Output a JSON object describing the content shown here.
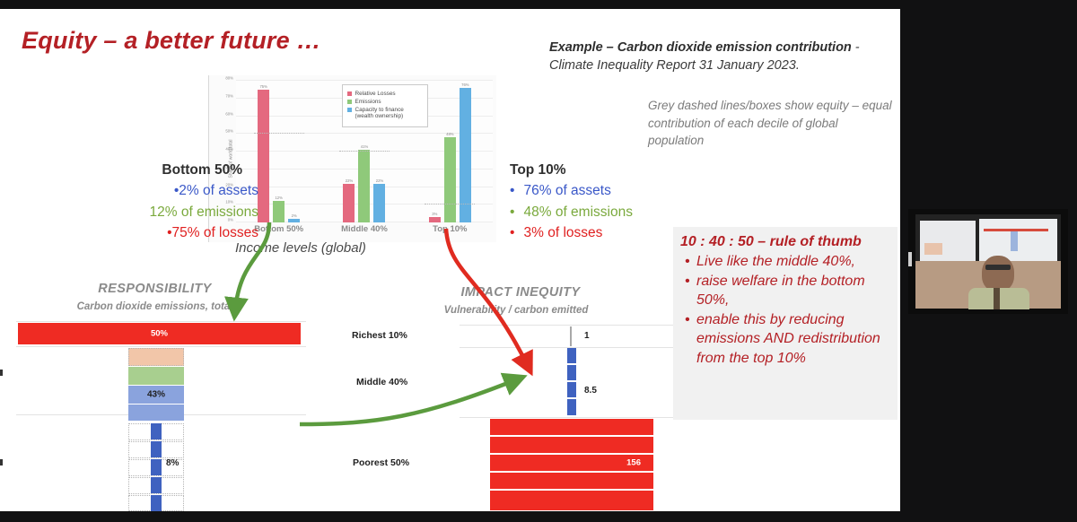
{
  "slide": {
    "title": "Equity – a better future …",
    "example_note_bold": "Example – Carbon dioxide emission contribution",
    "example_note_rest": " - Climate Inequality Report 31 January 2023.",
    "grey_note": "Grey dashed lines/boxes show equity – equal contribution of each decile of global population"
  },
  "stats": {
    "bottom": {
      "heading": "Bottom 50%",
      "rows": [
        {
          "text": "2% of assets",
          "color": "#3a58c8"
        },
        {
          "text": "12% of emissions",
          "color": "#7aa93c"
        },
        {
          "text": "75% of losses",
          "color": "#e02020"
        }
      ]
    },
    "top": {
      "heading": "Top 10%",
      "rows": [
        {
          "text": "76% of assets",
          "color": "#3a58c8"
        },
        {
          "text": "48% of emissions",
          "color": "#7aa93c"
        },
        {
          "text": "3% of losses",
          "color": "#e02020"
        }
      ]
    }
  },
  "rule_box": {
    "heading": "10 : 40 : 50 – rule of thumb",
    "bullets": [
      "Live like the middle 40%,",
      "raise welfare in the bottom 50%,",
      "enable this by reducing emissions AND redistribution from the top 10%"
    ],
    "color": "#b42025"
  },
  "responsibility": {
    "heading": "RESPONSIBILITY",
    "subheading": "Carbon dioxide emissions, total",
    "values": [
      {
        "label": "50%",
        "group": "top-10"
      },
      {
        "label": "43%",
        "group": "middle-40"
      },
      {
        "label": "8%",
        "group": "bottom-50"
      }
    ]
  },
  "impact": {
    "heading": "IMPACT INEQUITY",
    "subheading": "Vulnerability / carbon emitted",
    "categories": [
      "Richest 10%",
      "Middle 40%",
      "Poorest 50%"
    ],
    "values": [
      "1",
      "8.5",
      "156"
    ]
  },
  "chart_data": {
    "type": "bar",
    "title": "",
    "xlabel": "Income levels (global)",
    "ylabel": "Share of world total",
    "categories": [
      "Bottom 50%",
      "Middle 40%",
      "Top 10%"
    ],
    "ylim": [
      0,
      80
    ],
    "ytick_labels": [
      "0%",
      "10%",
      "20%",
      "30%",
      "40%",
      "50%",
      "60%",
      "70%",
      "80%"
    ],
    "grid": true,
    "legend_position": "inside-top-center",
    "series": [
      {
        "name": "Relative Losses",
        "color": "#e4697f",
        "values": [
          75,
          22,
          3
        ],
        "labels": [
          "75%",
          "22%",
          "3%"
        ]
      },
      {
        "name": "Emissions",
        "color": "#8fc97a",
        "values": [
          12,
          41,
          48
        ],
        "labels": [
          "12%",
          "41%",
          "48%"
        ]
      },
      {
        "name": "Capacity to finance (wealth ownership)",
        "color": "#62b0e2",
        "values": [
          2,
          22,
          76
        ],
        "labels": [
          "2%",
          "22%",
          "76%"
        ]
      }
    ],
    "equity_reference_lines": [
      50,
      40,
      10
    ],
    "annotations": []
  },
  "video": {
    "participant_label": ""
  }
}
